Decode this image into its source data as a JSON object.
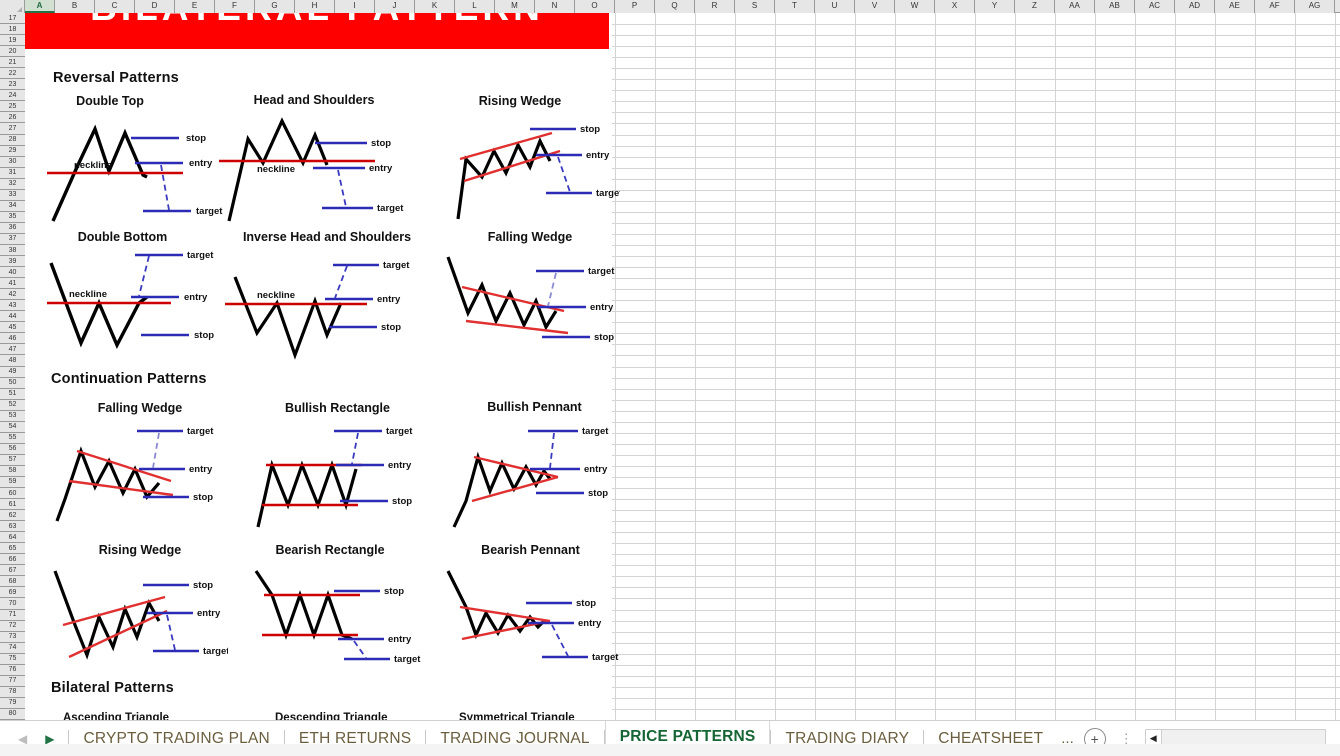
{
  "app": {
    "type": "spreadsheet",
    "grid_columns": [
      "A",
      "B",
      "C",
      "D",
      "E",
      "F",
      "G",
      "H",
      "I",
      "J",
      "K",
      "L",
      "M",
      "N",
      "O",
      "P",
      "Q",
      "R",
      "S",
      "T",
      "U",
      "V",
      "W",
      "X",
      "Y",
      "Z",
      "AA",
      "AB",
      "AC",
      "AD",
      "AE",
      "AF",
      "AG"
    ],
    "selected_column": "A",
    "grid_rows": [
      17,
      18,
      19,
      20,
      21,
      22,
      23,
      24,
      25,
      26,
      27,
      28,
      29,
      30,
      31,
      32,
      33,
      34,
      35,
      36,
      37,
      38,
      39,
      40,
      41,
      42,
      43,
      44,
      45,
      46,
      47,
      48,
      49,
      50,
      51,
      52,
      53,
      54,
      55,
      56,
      57,
      58,
      59,
      60,
      61,
      62,
      63,
      64,
      65,
      66,
      67,
      68,
      69,
      70,
      71,
      72,
      73,
      74,
      75,
      76,
      77,
      78,
      79,
      80
    ]
  },
  "cheatsheet": {
    "banner_text": "BILATERAL PATTERN",
    "banner_color": "#ff0000",
    "sections": [
      {
        "title": "Reversal Patterns"
      },
      {
        "title": "Continuation Patterns"
      },
      {
        "title": "Bilateral Patterns"
      }
    ],
    "reversal": [
      {
        "name": "Double Top",
        "labels": {
          "neckline": "neckline",
          "stop": "stop",
          "entry": "entry",
          "target": "target"
        }
      },
      {
        "name": "Head and Shoulders",
        "labels": {
          "neckline": "neckline",
          "stop": "stop",
          "entry": "entry",
          "target": "target"
        }
      },
      {
        "name": "Rising Wedge",
        "labels": {
          "stop": "stop",
          "entry": "entry",
          "target": "target"
        }
      },
      {
        "name": "Double Bottom",
        "labels": {
          "neckline": "neckline",
          "stop": "stop",
          "entry": "entry",
          "target": "target"
        }
      },
      {
        "name": "Inverse Head and Shoulders",
        "labels": {
          "neckline": "neckline",
          "stop": "stop",
          "entry": "entry",
          "target": "target"
        }
      },
      {
        "name": "Falling Wedge",
        "labels": {
          "stop": "stop",
          "entry": "entry",
          "target": "target"
        }
      }
    ],
    "continuation": [
      {
        "name": "Falling Wedge",
        "labels": {
          "stop": "stop",
          "entry": "entry",
          "target": "target"
        }
      },
      {
        "name": "Bullish Rectangle",
        "labels": {
          "stop": "stop",
          "entry": "entry",
          "target": "target"
        }
      },
      {
        "name": "Bullish Pennant",
        "labels": {
          "stop": "stop",
          "entry": "entry",
          "target": "target"
        }
      },
      {
        "name": "Rising Wedge",
        "labels": {
          "stop": "stop",
          "entry": "entry",
          "target": "target"
        }
      },
      {
        "name": "Bearish Rectangle",
        "labels": {
          "stop": "stop",
          "entry": "entry",
          "target": "target"
        }
      },
      {
        "name": "Bearish Pennant",
        "labels": {
          "stop": "stop",
          "entry": "entry",
          "target": "target"
        }
      }
    ],
    "bilateral": [
      {
        "name": "Ascending Triangle"
      },
      {
        "name": "Descending Triangle"
      },
      {
        "name": "Symmetrical Triangle"
      }
    ],
    "colors": {
      "price_line": "#000000",
      "neckline": "#cc0000",
      "trendline": "#e03030",
      "level_line": "#2b2bb5",
      "projection_line": "#3a3ac0"
    }
  },
  "tabbar": {
    "nav_prev": "◀",
    "nav_next": "▶",
    "tabs": [
      {
        "label": "CRYPTO TRADING PLAN",
        "active": false
      },
      {
        "label": "ETH RETURNS",
        "active": false
      },
      {
        "label": "TRADING JOURNAL",
        "active": false
      },
      {
        "label": "PRICE PATTERNS",
        "active": true
      },
      {
        "label": "TRADING DIARY",
        "active": false
      },
      {
        "label": "CHEATSHEET",
        "active": false
      }
    ],
    "overflow_ellipsis": "...",
    "add_sheet_label": "+",
    "kebab_label": "⋮",
    "scroll_left_arrow": "◀"
  }
}
